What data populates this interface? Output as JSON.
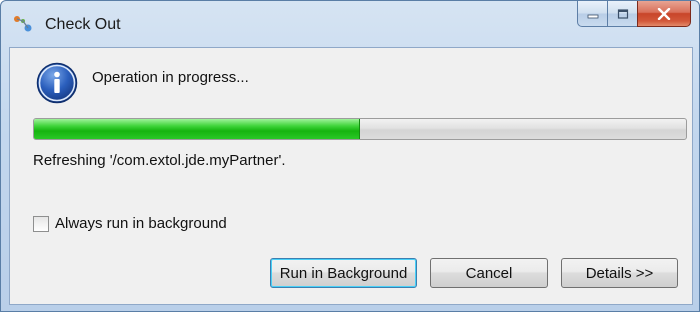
{
  "window": {
    "title": "Check Out",
    "app_icon": "team-share-icon",
    "caption_buttons": {
      "minimize_icon": "minimize-icon",
      "maximize_icon": "maximize-icon",
      "close_icon": "close-icon"
    }
  },
  "dialog": {
    "icon": "info-icon",
    "message": "Operation in progress...",
    "progress": {
      "percent": 50,
      "color": "#1fbf19"
    },
    "status": "Refreshing '/com.extol.jde.myPartner'.",
    "checkbox": {
      "label": "Always run in background",
      "checked": false
    },
    "buttons": {
      "run_background": "Run in Background",
      "cancel": "Cancel",
      "details": "Details >>"
    }
  }
}
